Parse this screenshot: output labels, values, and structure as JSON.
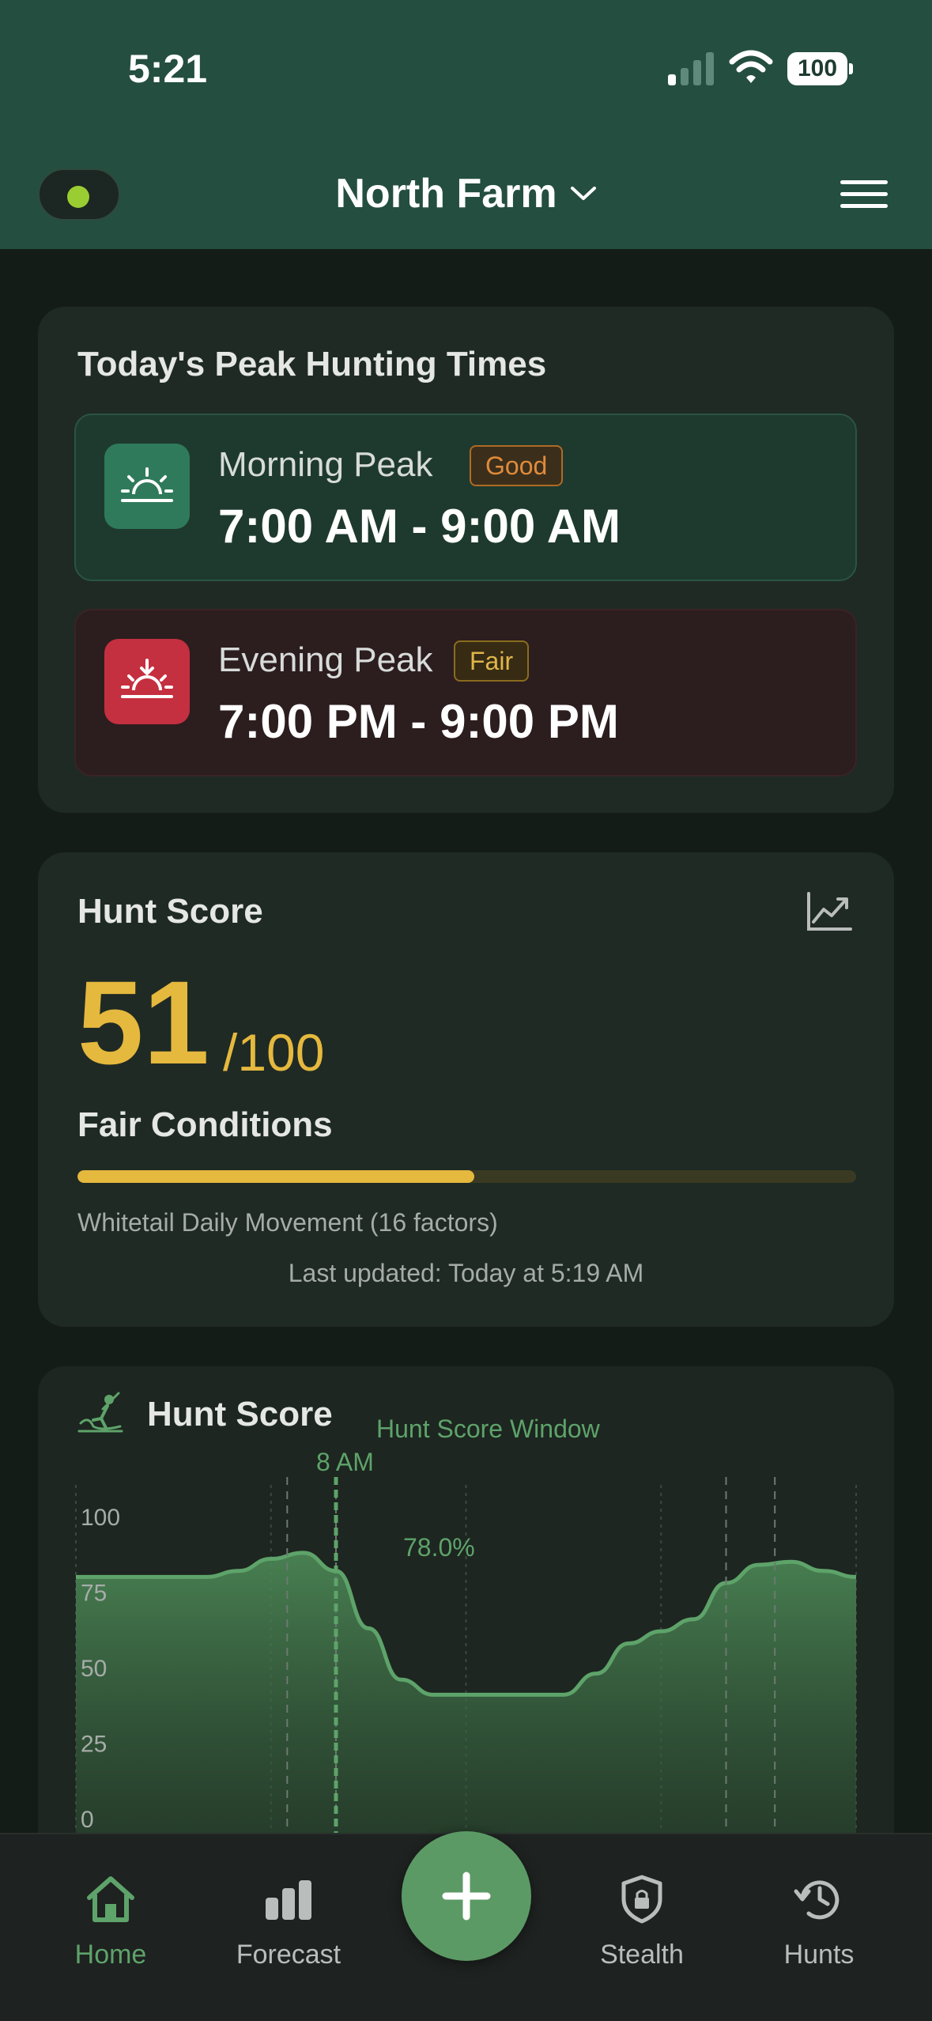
{
  "status_bar": {
    "time": "5:21",
    "battery": "100"
  },
  "header": {
    "farm_name": "North Farm"
  },
  "peak_card": {
    "title": "Today's Peak Hunting Times",
    "morning": {
      "label": "Morning Peak",
      "badge": "Good",
      "time": "7:00 AM - 9:00 AM",
      "icon": "sunrise-icon"
    },
    "evening": {
      "label": "Evening Peak",
      "badge": "Fair",
      "time": "7:00 PM - 9:00 PM",
      "icon": "sunset-icon"
    }
  },
  "score_card": {
    "title": "Hunt Score",
    "score": "51",
    "max": "/100",
    "score_fraction": 0.51,
    "conditions": "Fair Conditions",
    "movement": "Whitetail Daily Movement (16 factors)",
    "updated": "Last updated: Today at 5:19 AM",
    "accent": "#e5b83e"
  },
  "chart_card": {
    "title": "Hunt Score",
    "window_label": "Hunt Score Window",
    "marker_label": "8 AM",
    "marker_value": "78.0%"
  },
  "chart_data": {
    "type": "area",
    "title": "Hunt Score",
    "ylim": [
      0,
      100
    ],
    "yticks": [
      "100",
      "75",
      "50",
      "25",
      "0"
    ],
    "x_hours": [
      0,
      1,
      2,
      3,
      4,
      5,
      6,
      7,
      8,
      9,
      10,
      11,
      12,
      13,
      14,
      15,
      16,
      17,
      18,
      19,
      20,
      21,
      22,
      23,
      24
    ],
    "values": [
      80,
      80,
      80,
      80,
      80,
      82,
      86,
      88,
      82,
      63,
      46,
      41,
      41,
      41,
      41,
      41,
      48,
      58,
      62,
      66,
      78,
      84,
      85,
      82,
      80
    ],
    "marker_hour": 8,
    "window_lines_hours": [
      6.5,
      8,
      20,
      21.5
    ],
    "color": "#5ea36a"
  },
  "bottom_nav": {
    "items": [
      {
        "label": "Home",
        "icon": "home-icon",
        "active": true
      },
      {
        "label": "Forecast",
        "icon": "bar-chart-icon",
        "active": false
      },
      {
        "label": "Stealth",
        "icon": "shield-lock-icon",
        "active": false
      },
      {
        "label": "Hunts",
        "icon": "history-icon",
        "active": false
      }
    ],
    "fab_icon": "plus-icon"
  }
}
